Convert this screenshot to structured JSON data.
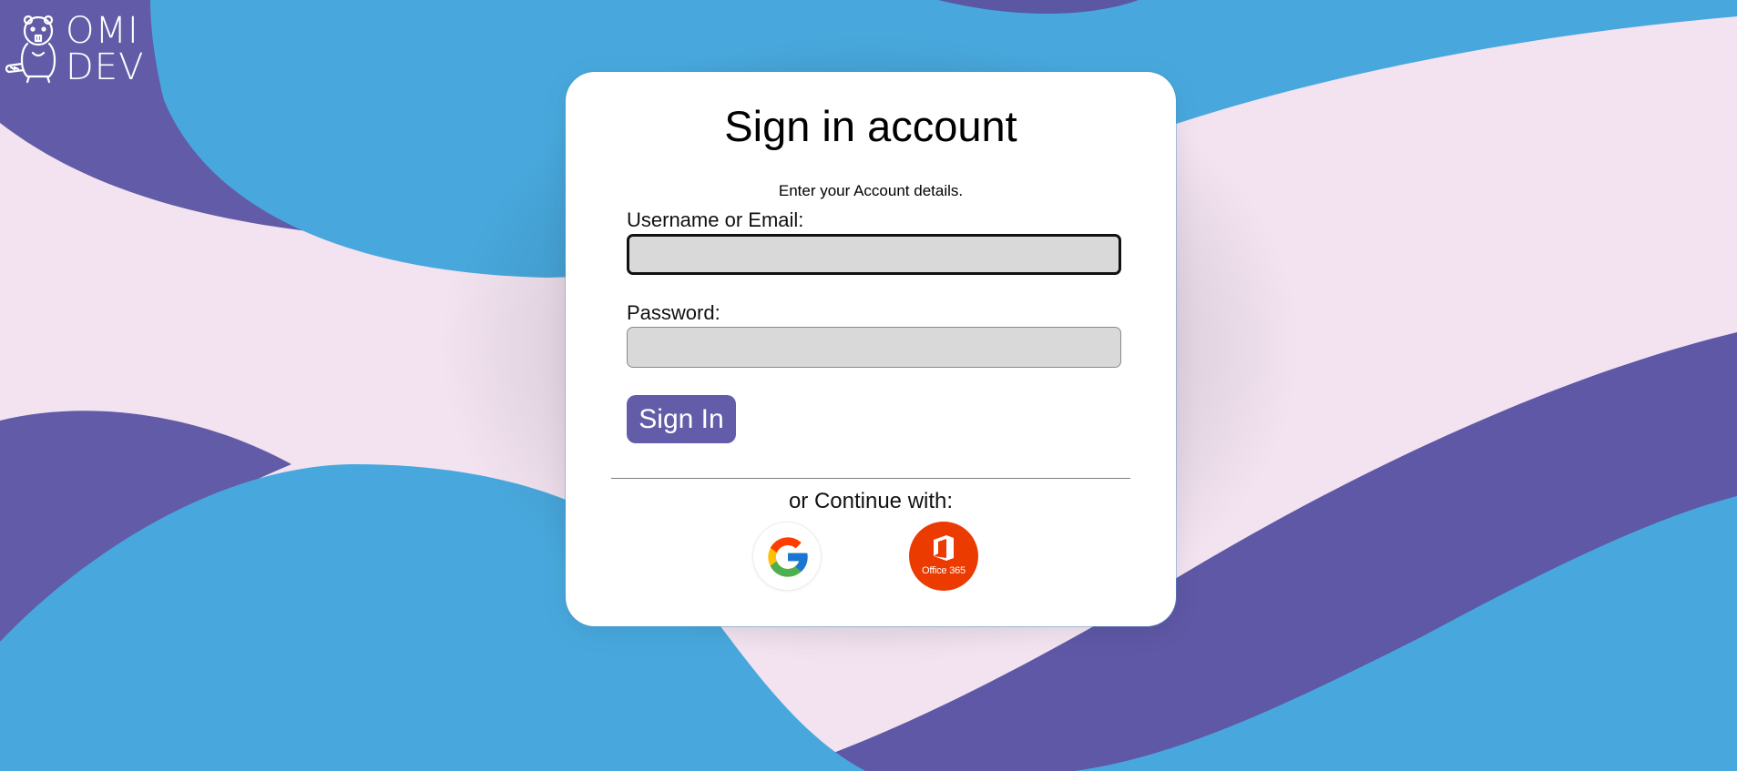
{
  "brand": {
    "logo_line1": "OMI",
    "logo_line2": "DEV"
  },
  "colors": {
    "background_pink": "#f3e3f1",
    "wave_blue": "#48a8dd",
    "wave_purple": "#625ca8",
    "button_purple": "#635da9",
    "office_orange": "#eb3b00"
  },
  "form": {
    "title": "Sign in account",
    "subtitle": "Enter your Account details.",
    "username_label": "Username or Email:",
    "username_value": "",
    "password_label": "Password:",
    "password_value": "",
    "submit_label": "Sign In"
  },
  "social": {
    "continue_text": "or Continue with:",
    "providers": [
      {
        "id": "google",
        "icon": "google-icon"
      },
      {
        "id": "office365",
        "icon": "office365-icon",
        "label": "Office 365"
      }
    ]
  }
}
